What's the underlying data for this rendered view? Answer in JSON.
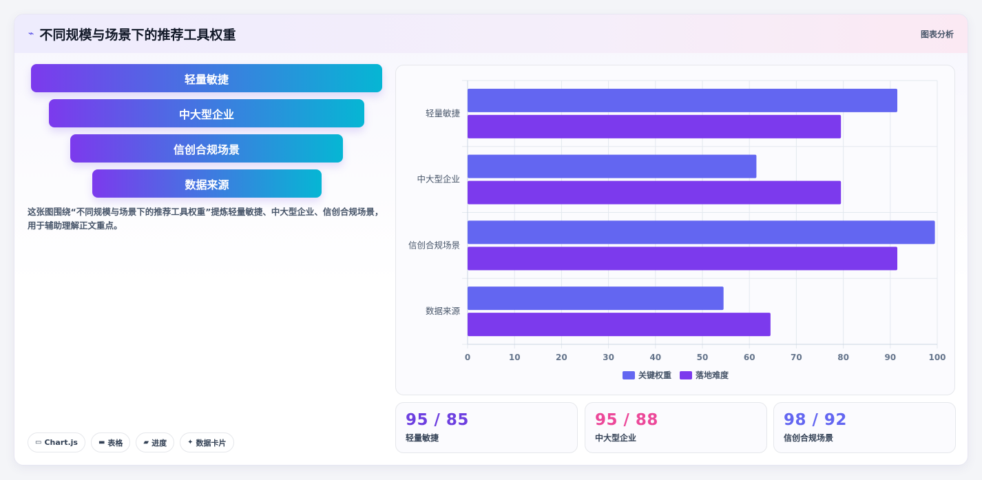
{
  "header": {
    "title": "不同规模与场景下的推荐工具权重",
    "tag": "图表分析",
    "icon": "trend-line-icon"
  },
  "funnel": {
    "steps": [
      "轻量敏捷",
      "中大型企业",
      "信创合规场景",
      "数据来源"
    ]
  },
  "description": "这张图围绕“不同规模与场景下的推荐工具权重”提炼轻量敏捷、中大型企业、信创合规场景，用于辅助理解正文重点。",
  "chips": [
    {
      "icon": "window-icon",
      "label": "Chart.js"
    },
    {
      "icon": "table-icon",
      "label": "表格"
    },
    {
      "icon": "folder-icon",
      "label": "进度"
    },
    {
      "icon": "sparkle-icon",
      "label": "数据卡片"
    }
  ],
  "chart_data": {
    "type": "bar",
    "orientation": "horizontal",
    "categories": [
      "轻量敏捷",
      "中大型企业",
      "信创合规场景",
      "数据来源"
    ],
    "series": [
      {
        "name": "关键权重",
        "color": "#6366f1",
        "values": [
          91.5,
          61.5,
          99.5,
          54.5
        ]
      },
      {
        "name": "落地难度",
        "color": "#7c3aed",
        "values": [
          79.5,
          79.5,
          91.5,
          64.5
        ]
      }
    ],
    "xlim": [
      0,
      100
    ],
    "xticks": [
      "0",
      "10",
      "20",
      "30",
      "40",
      "50",
      "60",
      "70",
      "80",
      "90",
      "100"
    ],
    "grid": true,
    "legend": "bottom"
  },
  "stats": [
    {
      "value": "95 / 85",
      "label": "轻量敏捷",
      "color": "#6d3fe0"
    },
    {
      "value": "95 / 88",
      "label": "中大型企业",
      "color": "#ec4899"
    },
    {
      "value": "98 / 92",
      "label": "信创合规场景",
      "color": "#6366f1"
    }
  ]
}
